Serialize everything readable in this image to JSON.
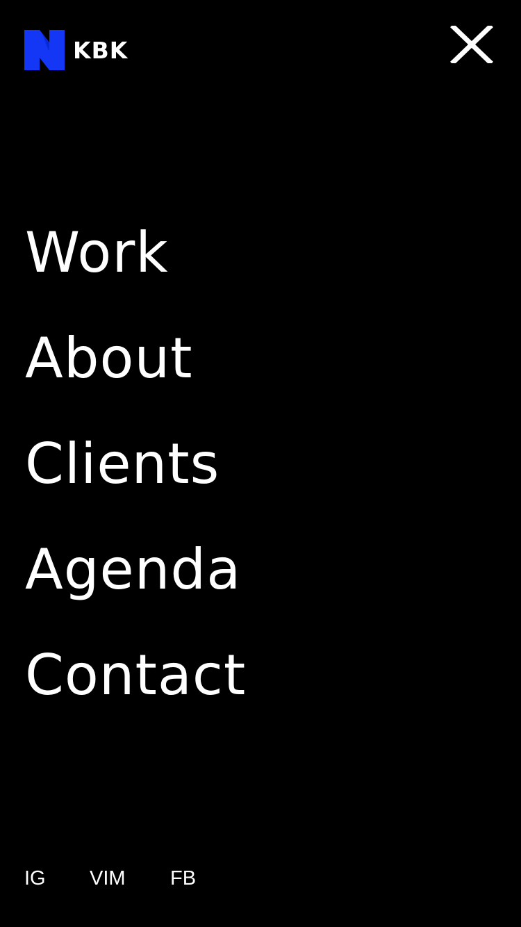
{
  "brand": {
    "name": "KBK",
    "logo_icon": "brand-n-mark-icon",
    "logo_color": "#1436f5"
  },
  "header": {
    "close_icon": "close-icon"
  },
  "menu": {
    "items": [
      {
        "label": "Work"
      },
      {
        "label": "About"
      },
      {
        "label": "Clients"
      },
      {
        "label": "Agenda"
      },
      {
        "label": "Contact"
      }
    ]
  },
  "social": {
    "links": [
      {
        "label": "IG"
      },
      {
        "label": "VIM"
      },
      {
        "label": "FB"
      }
    ]
  },
  "colors": {
    "background": "#000000",
    "text": "#ffffff",
    "accent": "#1436f5"
  }
}
